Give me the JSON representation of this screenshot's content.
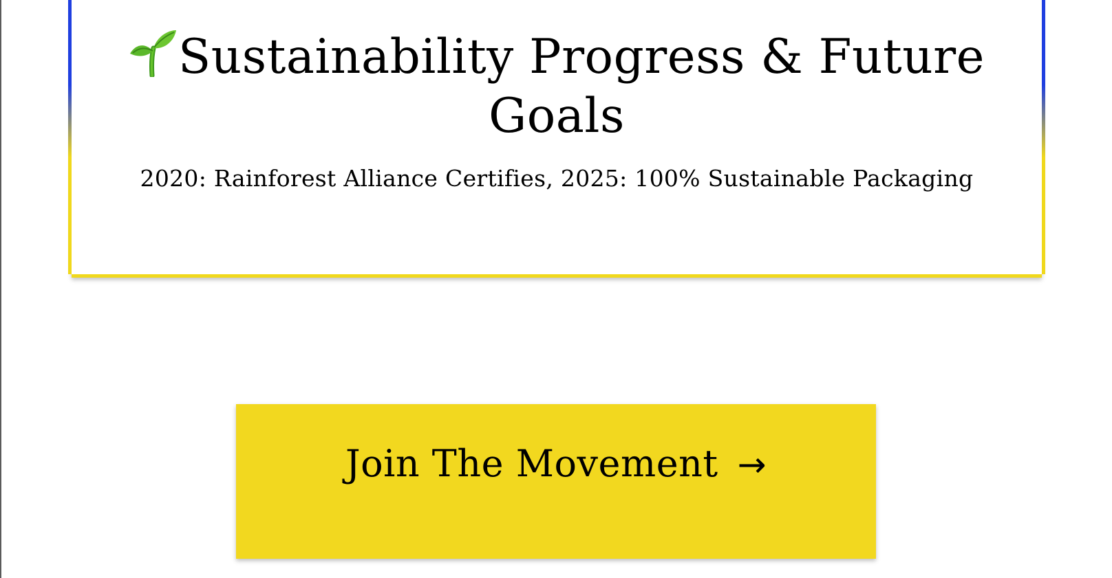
{
  "hero": {
    "title": "Sustainability Progress & Future Goals",
    "icon": "seedling-icon",
    "subtitle": "2020: Rainforest Alliance Certifies, 2025: 100% Sustainable Packaging"
  },
  "cta": {
    "label": "Join The Movement",
    "arrow": "→",
    "background_color": "#f2d81f"
  },
  "colors": {
    "border_top": "#1f3fe0",
    "border_bottom": "#f0d81c",
    "cta_yellow": "#f2d81f"
  }
}
